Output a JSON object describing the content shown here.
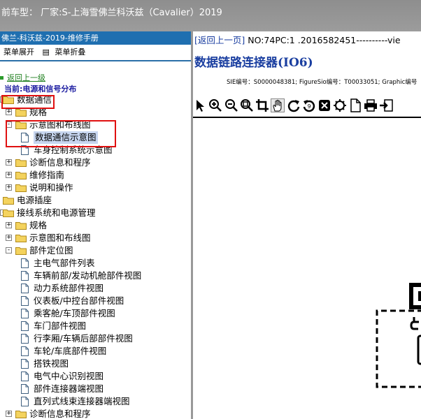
{
  "topbar": {
    "title": "前车型：  厂家:S-上海雪佛兰科沃兹（Cavalier）2019"
  },
  "left": {
    "header": "佛兰-科沃兹-2019-维修手册",
    "menu_expand": "菜单展开",
    "menu_collapse": "菜单折叠",
    "back_link": "返回上一级",
    "current": "当前:电源和信号分布"
  },
  "tree": [
    {
      "label": "数据通信",
      "level": 0,
      "type": "folder",
      "pm": "-"
    },
    {
      "label": "规格",
      "level": 1,
      "type": "folder",
      "pm": "+"
    },
    {
      "label": "示意图和布线图",
      "level": 1,
      "type": "folder",
      "pm": "-"
    },
    {
      "label": "数据通信示意图",
      "level": 2,
      "type": "doc",
      "selected": true
    },
    {
      "label": "车身控制系统示意图",
      "level": 2,
      "type": "doc"
    },
    {
      "label": "诊断信息和程序",
      "level": 1,
      "type": "folder",
      "pm": "+"
    },
    {
      "label": "维修指南",
      "level": 1,
      "type": "folder",
      "pm": "+"
    },
    {
      "label": "说明和操作",
      "level": 1,
      "type": "folder",
      "pm": "+"
    },
    {
      "label": "电源插座",
      "level": 0,
      "type": "folder"
    },
    {
      "label": "接线系统和电源管理",
      "level": 0,
      "type": "folder",
      "pm": "-"
    },
    {
      "label": "规格",
      "level": 1,
      "type": "folder",
      "pm": "+"
    },
    {
      "label": "示意图和布线图",
      "level": 1,
      "type": "folder",
      "pm": "+"
    },
    {
      "label": "部件定位图",
      "level": 1,
      "type": "folder",
      "pm": "-"
    },
    {
      "label": "主电气部件列表",
      "level": 2,
      "type": "doc"
    },
    {
      "label": "车辆前部/发动机舱部件视图",
      "level": 2,
      "type": "doc"
    },
    {
      "label": "动力系统部件视图",
      "level": 2,
      "type": "doc"
    },
    {
      "label": "仪表板/中控台部件视图",
      "level": 2,
      "type": "doc"
    },
    {
      "label": "乘客舱/车顶部件视图",
      "level": 2,
      "type": "doc"
    },
    {
      "label": "车门部件视图",
      "level": 2,
      "type": "doc"
    },
    {
      "label": "行李厢/车辆后部部件视图",
      "level": 2,
      "type": "doc"
    },
    {
      "label": "车轮/车底部件视图",
      "level": 2,
      "type": "doc"
    },
    {
      "label": "搭铁视图",
      "level": 2,
      "type": "doc"
    },
    {
      "label": "电气中心识别视图",
      "level": 2,
      "type": "doc"
    },
    {
      "label": "部件连接器端视图",
      "level": 2,
      "type": "doc"
    },
    {
      "label": "直列式线束连接器端视图",
      "level": 2,
      "type": "doc"
    },
    {
      "label": "诊断信息和程序",
      "level": 1,
      "type": "folder",
      "pm": "+"
    }
  ],
  "right": {
    "breadcrumb_back": "[返回上一页]",
    "breadcrumb_rest": " NO:74PC:1 .2016582451----------vie",
    "doc_title": "数据链路连接器(IO6)",
    "meta": "SIE编号：S0000048381;  FigureSio编号：T00033051;  Graphic编号"
  },
  "toolbar_icons": [
    "pointer-icon",
    "zoom-in-icon",
    "zoom-out-icon",
    "zoom-fit-icon",
    "crop-icon",
    "pan-hand-icon",
    "rotate-right-icon",
    "rotate-left-icon",
    "fullscreen-icon",
    "settings-gear-icon",
    "page-icon",
    "print-icon",
    "export-icon"
  ],
  "colors": {
    "topbar": "#999999",
    "header_blue": "#1f6fb0",
    "link_blue": "#1a3ea0",
    "highlight_red": "#e01010",
    "selected_bg": "#c7d6f0",
    "folder_yellow": "#f4d35e"
  }
}
